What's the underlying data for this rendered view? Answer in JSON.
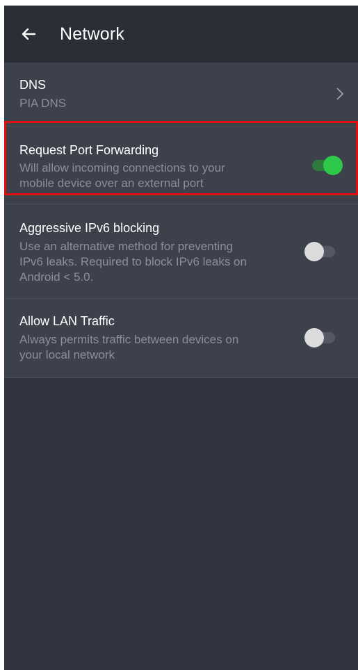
{
  "header": {
    "title": "Network",
    "back_icon": "arrow-left-icon"
  },
  "settings": {
    "dns": {
      "title": "DNS",
      "value": "PIA DNS",
      "chevron_icon": "chevron-right-icon"
    },
    "port_forwarding": {
      "title": "Request Port Forwarding",
      "desc_line1": "Will allow incoming connections to your",
      "desc_line2": "mobile device over an external port",
      "enabled": true
    },
    "ipv6_blocking": {
      "title": "Aggressive IPv6 blocking",
      "desc_line1": "Use an alternative method for preventing",
      "desc_line2": "IPv6 leaks. Required to block IPv6 leaks on",
      "desc_line3": "Android < 5.0.",
      "enabled": false
    },
    "lan_traffic": {
      "title": "Allow LAN Traffic",
      "desc_line1": "Always permits traffic between devices on",
      "desc_line2": "your local network",
      "enabled": false
    }
  },
  "colors": {
    "app_bar": "#2b2e36",
    "background": "#32353f",
    "row_background": "#3d414c",
    "toggle_on": "#2ec84a",
    "highlight": "#e01010"
  }
}
